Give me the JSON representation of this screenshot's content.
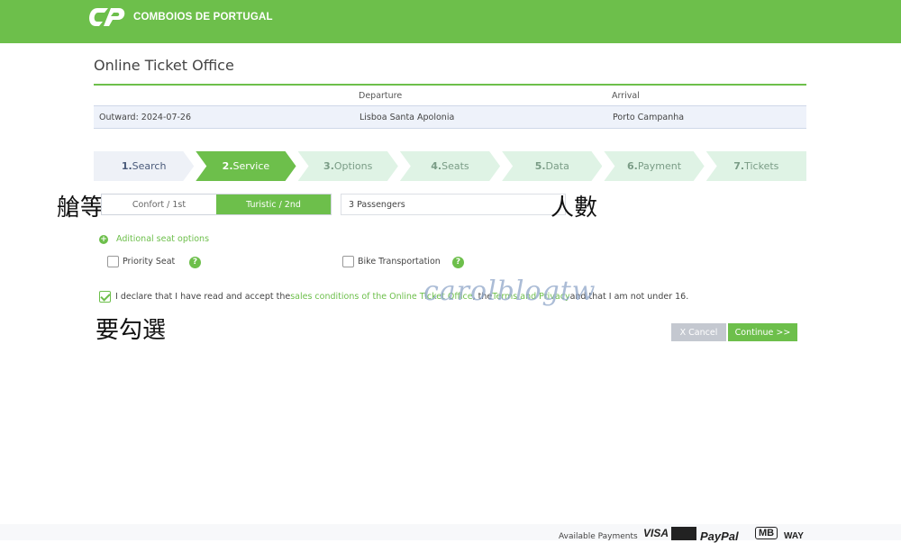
{
  "header": {
    "brand": "COMBOIOS DE PORTUGAL",
    "logo_icon": "cp-logo-icon",
    "color": "#6dbf4b"
  },
  "page_title": "Online Ticket Office",
  "journey": {
    "col_departure": "Departure",
    "col_arrival": "Arrival",
    "outward": "Outward: 2024-07-26",
    "departure": "Lisboa Santa Apolonia",
    "arrival": "Porto Campanha"
  },
  "steps": [
    {
      "num": "1.",
      "label": "Search"
    },
    {
      "num": "2.",
      "label": "Service"
    },
    {
      "num": "3.",
      "label": "Options"
    },
    {
      "num": "4.",
      "label": "Seats"
    },
    {
      "num": "5.",
      "label": "Data"
    },
    {
      "num": "6.",
      "label": "Payment"
    },
    {
      "num": "7.",
      "label": "Tickets"
    }
  ],
  "active_step": 2,
  "class_options": {
    "first": "Confort / 1st",
    "second": "Turistic / 2nd",
    "selected": "Turistic / 2nd"
  },
  "passengers": "3 Passengers",
  "annotations": {
    "class_label": "艙等",
    "passengers_label": "人數",
    "check_label": "要勾選"
  },
  "seat_options": {
    "link": "Aditional seat options",
    "priority_seat": "Priority Seat",
    "bike": "Bike Transportation"
  },
  "declaration": {
    "prefix": "I declare that I have read and accept the ",
    "link1": "sales conditions of the Online Ticket Office",
    "middle": ", the ",
    "link2": "Terms and Privacy",
    "suffix": " and that I am not under 16.",
    "checked": true
  },
  "watermark": "carolblogtw",
  "buttons": {
    "cancel": "X Cancel",
    "continue": "Continue >>"
  },
  "footer": {
    "available_payments": "Available Payments",
    "methods": [
      "VISA",
      "PayPal",
      "MB",
      "WAY"
    ]
  }
}
